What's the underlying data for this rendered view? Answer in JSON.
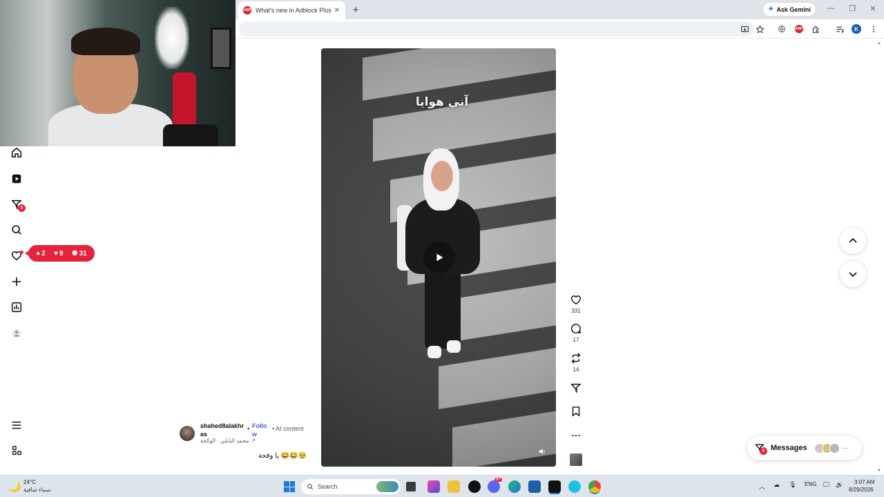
{
  "browser": {
    "tab_title": "What's new in Adblock Plus",
    "tab_favicon": "ABP",
    "tab_close": "✕",
    "new_tab": "+",
    "ask_gemini": "Ask Gemini",
    "profile_initial": "K",
    "abp_badge": "ABP"
  },
  "nav": {
    "notifications_badge": "6",
    "activity": {
      "comments": "2",
      "likes": "9",
      "followers": "31"
    }
  },
  "video": {
    "caption_overlay": "آني هوايا"
  },
  "actions": {
    "likes": "331",
    "comments": "17",
    "reposts": "14"
  },
  "post": {
    "author": "shahed8alakhras",
    "separator": "•",
    "follow": "Follow",
    "ai_label": "• AI content",
    "music": "↗ محمد البابلي · الوكحة",
    "caption": "يا وقحة 😂😂🥹"
  },
  "messages": {
    "label": "Messages",
    "badge": "6",
    "more": "···"
  },
  "taskbar": {
    "temperature": "24°C",
    "weather_desc": "سماء صافية",
    "search_placeholder": "Search",
    "language": "ENG",
    "time": "3:07 AM",
    "date": "8/29/2026",
    "discord_badge": "9+"
  },
  "colors": {
    "accent_red": "#e5243b",
    "follow_blue": "#4a5ce8",
    "taskbar_bg": "#dde4ec"
  }
}
